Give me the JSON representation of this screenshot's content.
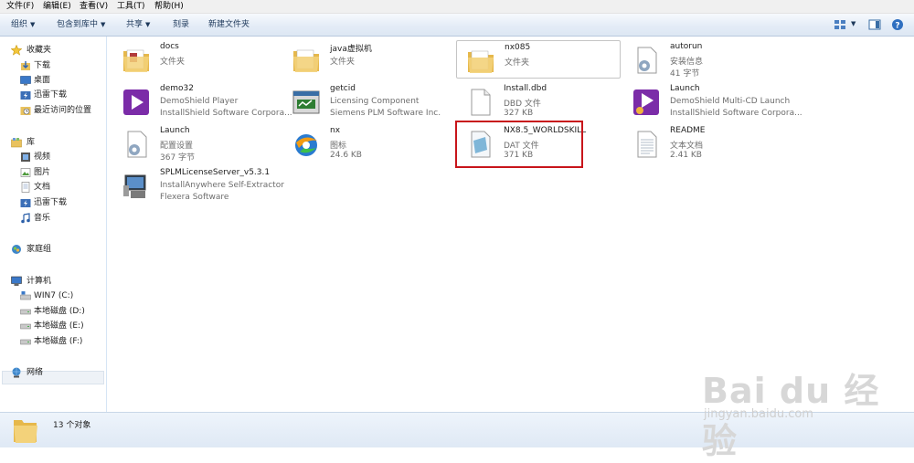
{
  "menu": {
    "items": [
      "文件(F)",
      "编辑(E)",
      "查看(V)",
      "工具(T)",
      "帮助(H)"
    ]
  },
  "toolbar": {
    "organize": "组织",
    "include_library": "包含到库中",
    "share": "共享",
    "burn": "刻录",
    "new_folder": "新建文件夹"
  },
  "nav": {
    "favorites": {
      "header": "收藏夹",
      "items": [
        "下载",
        "桌面",
        "迅雷下载",
        "最近访问的位置"
      ]
    },
    "libraries": {
      "header": "库",
      "items": [
        "视频",
        "图片",
        "文档",
        "迅雷下载",
        "音乐"
      ]
    },
    "homegroup": "家庭组",
    "computer": {
      "header": "计算机",
      "drives": [
        "WIN7 (C:)",
        "本地磁盘 (D:)",
        "本地磁盘 (E:)",
        "本地磁盘 (F:)"
      ]
    },
    "network": "网络"
  },
  "files": [
    {
      "name": "docs",
      "type": "文件夹",
      "extra": "",
      "icon": "folder-icon"
    },
    {
      "name": "java虚拟机",
      "type": "文件夹",
      "extra": "",
      "icon": "folder-icon"
    },
    {
      "name": "nx085",
      "type": "文件夹",
      "extra": "",
      "icon": "folder-icon"
    },
    {
      "name": "autorun",
      "type": "安装信息",
      "extra": "41 字节",
      "icon": "settings-file-icon"
    },
    {
      "name": "demo32",
      "type": "DemoShield Player",
      "extra": "InstallShield Software Corpora...",
      "icon": "demoshield-icon"
    },
    {
      "name": "getcid",
      "type": "Licensing Component",
      "extra": "Siemens PLM Software Inc.",
      "icon": "license-app-icon"
    },
    {
      "name": "Install.dbd",
      "type": "DBD 文件",
      "extra": "327 KB",
      "icon": "blank-file-icon"
    },
    {
      "name": "Launch",
      "type": "DemoShield Multi-CD Launch",
      "extra": "InstallShield Software Corpora...",
      "icon": "demoshield-launch-icon"
    },
    {
      "name": "Launch",
      "type": "配置设置",
      "extra": "367 字节",
      "icon": "settings-file-icon"
    },
    {
      "name": "nx",
      "type": "图标",
      "extra": "24.6 KB",
      "icon": "nx-logo-icon"
    },
    {
      "name": "NX8.5_WORLDSKILL",
      "type": "DAT 文件",
      "extra": "371 KB",
      "icon": "dat-file-icon"
    },
    {
      "name": "README",
      "type": "文本文档",
      "extra": "2.41 KB",
      "icon": "text-file-icon"
    },
    {
      "name": "SPLMLicenseServer_v5.3.1",
      "type": "InstallAnywhere Self-Extractor",
      "extra": "Flexera Software",
      "icon": "installer-icon"
    }
  ],
  "status": {
    "count": "13 个对象"
  },
  "watermark": {
    "brand": "Bai du 经验",
    "url": "jingyan.baidu.com"
  },
  "colors": {
    "highlight_box": "#c8151b",
    "toolbar_text": "#1e395b"
  }
}
